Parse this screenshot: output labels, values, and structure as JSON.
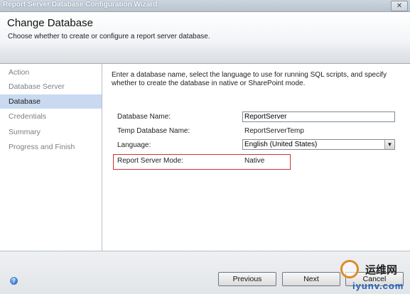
{
  "window": {
    "title": "Report Server Database Configuration Wizard",
    "close_glyph": "✕"
  },
  "header": {
    "title": "Change Database",
    "subtitle": "Choose whether to create or configure a report server database."
  },
  "sidebar": {
    "items": [
      {
        "label": "Action",
        "active": false
      },
      {
        "label": "Database Server",
        "active": false
      },
      {
        "label": "Database",
        "active": true
      },
      {
        "label": "Credentials",
        "active": false
      },
      {
        "label": "Summary",
        "active": false
      },
      {
        "label": "Progress and Finish",
        "active": false
      }
    ]
  },
  "main": {
    "description": "Enter a database name, select the language to use for running SQL scripts, and specify whether to create the database in native or SharePoint mode.",
    "database_name_label": "Database Name:",
    "database_name_value": "ReportServer",
    "temp_db_label": "Temp Database Name:",
    "temp_db_value": "ReportServerTemp",
    "language_label": "Language:",
    "language_value": "English (United States)",
    "mode_label": "Report Server Mode:",
    "mode_value": "Native"
  },
  "footer": {
    "help_glyph": "?",
    "previous_label": "Previous",
    "next_label": "Next",
    "cancel_label": "Cancel"
  },
  "watermark": {
    "cn_text": "运维网",
    "url_text": "iyunv.com"
  },
  "colors": {
    "accent_selection": "#c9daf0",
    "highlight_border": "#cc3333"
  }
}
